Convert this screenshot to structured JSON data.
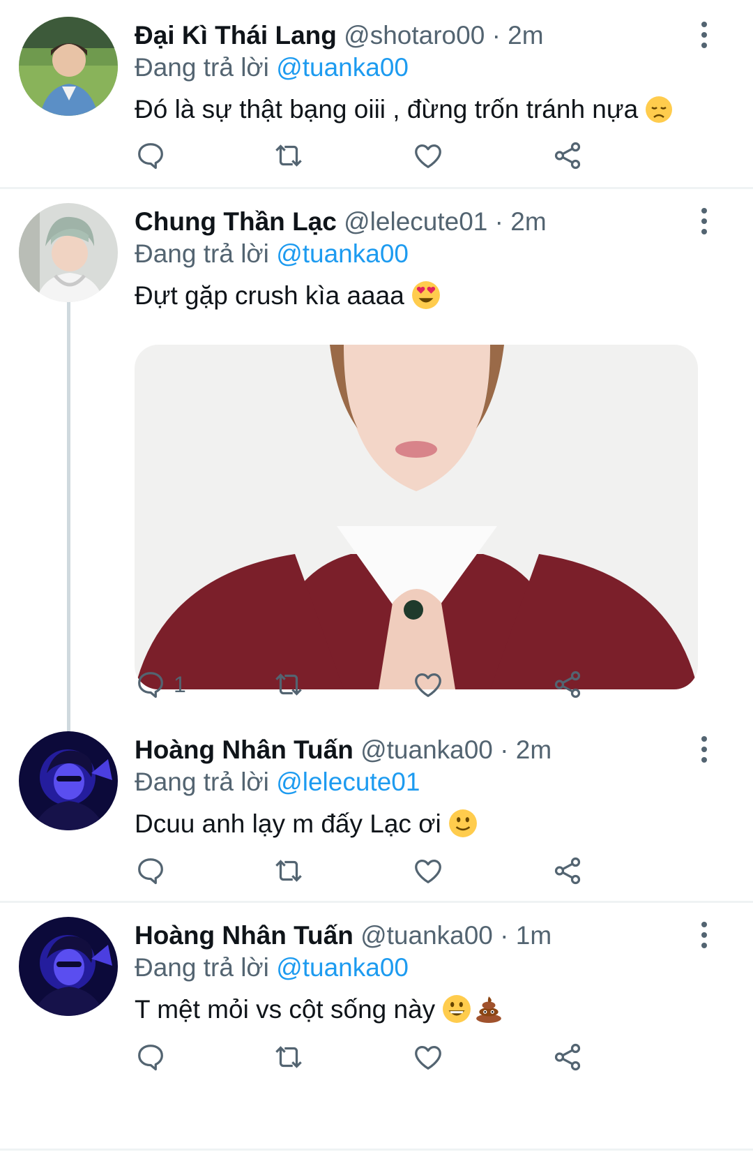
{
  "replying_to_label": "Đang trả lời",
  "tweets": [
    {
      "name": "Đại Kì Thái Lang",
      "handle": "@shotaro00",
      "dot": "·",
      "time": "2m",
      "reply_to": "@tuanka00",
      "text": "Đó là sự thật bạng oiii , đừng trốn tránh nựa",
      "emoji": "disappointed-face-emoji",
      "reply_count": "",
      "avatar": "avatar-shotaro00"
    },
    {
      "name": "Chung Thần Lạc",
      "handle": "@lelecute01",
      "dot": "·",
      "time": "2m",
      "reply_to": "@tuanka00",
      "text": "Đựt gặp crush kìa aaaa",
      "emoji": "heart-eyes-emoji",
      "reply_count": "1",
      "avatar": "avatar-lelecute01",
      "has_media": true
    },
    {
      "name": "Hoàng Nhân Tuấn",
      "handle": "@tuanka00",
      "dot": "·",
      "time": "2m",
      "reply_to": "@lelecute01",
      "text": "Dcuu anh lạy m đấy Lạc ơi",
      "emoji": "slightly-smiling-emoji",
      "reply_count": "",
      "avatar": "avatar-tuanka00"
    },
    {
      "name": "Hoàng Nhân Tuấn",
      "handle": "@tuanka00",
      "dot": "·",
      "time": "1m",
      "reply_to": "@tuanka00",
      "text": "T mệt mỏi vs cột sống này",
      "emoji": "grinning-and-poo-emoji",
      "reply_count": "",
      "avatar": "avatar-tuanka00"
    }
  ],
  "icons": [
    "reply-icon",
    "retweet-icon",
    "like-icon",
    "share-icon",
    "more-icon"
  ],
  "colors": {
    "mention": "#1d9bf0",
    "secondary_text": "#536471",
    "thread_line": "#cfd9de"
  }
}
